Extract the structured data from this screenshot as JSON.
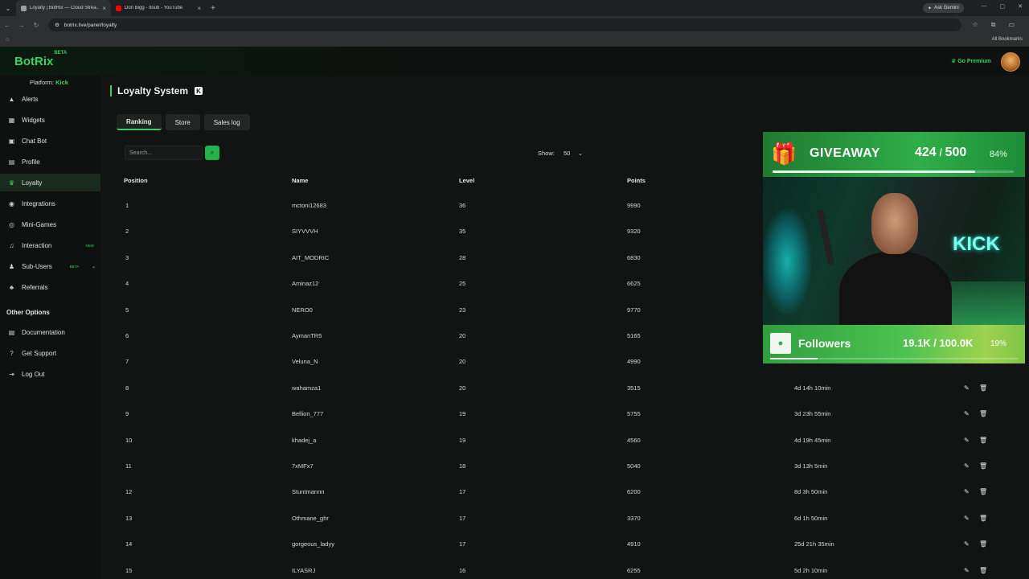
{
  "browser": {
    "tabs": [
      {
        "title": "Loyalty | BotRix — Cloud Strea...",
        "favicon_color": "#9aa0a6",
        "active": true
      },
      {
        "title": "Don Bigg - Itoub - YouTube",
        "favicon_color": "#ff0000",
        "active": false
      }
    ],
    "ask_gemini": "Ask Gemini",
    "url": "botrix.live/panel/loyalty",
    "all_bookmarks": "All Bookmarks"
  },
  "app": {
    "logo": "BotRix",
    "logo_beta": "BETA",
    "go_premium": "Go Premium",
    "platform_label": "Platform:",
    "platform_value": "Kick"
  },
  "sidebar": {
    "items": [
      {
        "label": "Alerts",
        "icon": "warning-icon",
        "glyph": "▲"
      },
      {
        "label": "Widgets",
        "icon": "grid-icon",
        "glyph": "▦"
      },
      {
        "label": "Chat Bot",
        "icon": "robot-icon",
        "glyph": "▣"
      },
      {
        "label": "Profile",
        "icon": "profile-card-icon",
        "glyph": "▤"
      },
      {
        "label": "Loyalty",
        "icon": "trophy-icon",
        "glyph": "♛",
        "active": true
      },
      {
        "label": "Integrations",
        "icon": "link-icon",
        "glyph": "◉"
      },
      {
        "label": "Mini-Games",
        "icon": "gamepad-icon",
        "glyph": "◎"
      },
      {
        "label": "Interaction",
        "icon": "music-icon",
        "glyph": "♫",
        "badge": "NEW"
      },
      {
        "label": "Sub-Users",
        "icon": "users-icon",
        "glyph": "♟",
        "badge": "BETA",
        "chevron": true
      },
      {
        "label": "Referrals",
        "icon": "referral-icon",
        "glyph": "♣"
      }
    ],
    "other_options_title": "Other Options",
    "other_items": [
      {
        "label": "Documentation",
        "icon": "book-icon",
        "glyph": "▤"
      },
      {
        "label": "Get Support",
        "icon": "help-icon",
        "glyph": "?"
      },
      {
        "label": "Log Out",
        "icon": "logout-icon",
        "glyph": "⇥"
      }
    ]
  },
  "page": {
    "title": "Loyalty System",
    "kick_badge": "K",
    "tabs": [
      "Ranking",
      "Store",
      "Sales log"
    ],
    "search_placeholder": "Search...",
    "show_label": "Show:",
    "show_value": "50",
    "columns": {
      "position": "Position",
      "name": "Name",
      "level": "Level",
      "points": "Points"
    }
  },
  "table_rows": [
    {
      "pos": "1",
      "name": "mctoni12683",
      "level": "36",
      "points": "9990",
      "time": ""
    },
    {
      "pos": "2",
      "name": "SIYVVVH",
      "level": "35",
      "points": "9320",
      "time": ""
    },
    {
      "pos": "3",
      "name": "AIT_MODRIC",
      "level": "28",
      "points": "6830",
      "time": ""
    },
    {
      "pos": "4",
      "name": "Aminaz12",
      "level": "25",
      "points": "6625",
      "time": ""
    },
    {
      "pos": "5",
      "name": "NERO0",
      "level": "23",
      "points": "9770",
      "time": ""
    },
    {
      "pos": "6",
      "name": "AymanTR5",
      "level": "20",
      "points": "5165",
      "time": ""
    },
    {
      "pos": "7",
      "name": "Veluna_N",
      "level": "20",
      "points": "4990",
      "time": ""
    },
    {
      "pos": "8",
      "name": "wahamza1",
      "level": "20",
      "points": "3515",
      "time": "4d 14h 10min"
    },
    {
      "pos": "9",
      "name": "Bellion_777",
      "level": "19",
      "points": "5755",
      "time": "3d 23h 55min"
    },
    {
      "pos": "10",
      "name": "khadej_a",
      "level": "19",
      "points": "4560",
      "time": "4d 19h 45min"
    },
    {
      "pos": "11",
      "name": "7xMFx7",
      "level": "18",
      "points": "5040",
      "time": "3d 13h 5min"
    },
    {
      "pos": "12",
      "name": "Stuntmannn",
      "level": "17",
      "points": "6200",
      "time": "8d 3h 50min"
    },
    {
      "pos": "13",
      "name": "Othmane_ghr",
      "level": "17",
      "points": "3370",
      "time": "6d 1h 50min"
    },
    {
      "pos": "14",
      "name": "gorgeous_ladyy",
      "level": "17",
      "points": "4910",
      "time": "25d 21h 35min"
    },
    {
      "pos": "15",
      "name": "ILYASRJ",
      "level": "16",
      "points": "6255",
      "time": "5d 2h 10min"
    }
  ],
  "giveaway": {
    "title": "GIVEAWAY",
    "current": "424",
    "total": "500",
    "percent": "84%",
    "progress": 0.84
  },
  "followers": {
    "title": "Followers",
    "count": "19.1K / 100.0K",
    "percent": "19%",
    "progress": 0.19
  },
  "colors": {
    "accent": "#3ccf62",
    "background": "#121413"
  }
}
